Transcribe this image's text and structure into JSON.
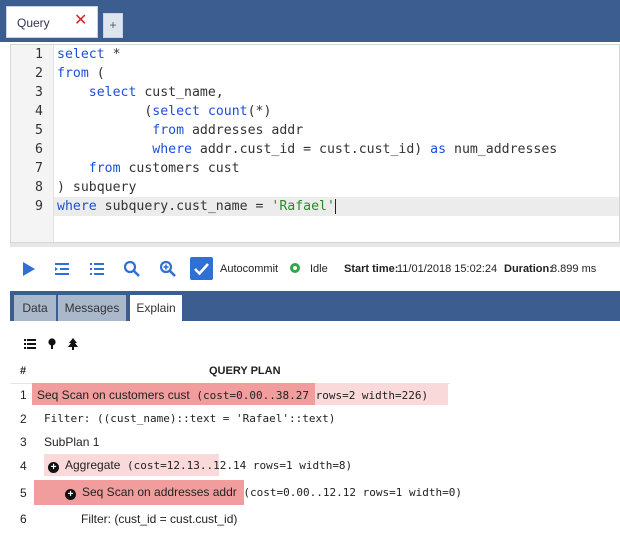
{
  "query_tab": {
    "label": "Query",
    "close": "✕",
    "add": "+"
  },
  "editor": {
    "lines": [
      {
        "n": "1",
        "parts": [
          {
            "t": "select",
            "c": "kw"
          },
          {
            "t": " *",
            "c": ""
          }
        ]
      },
      {
        "n": "2",
        "parts": [
          {
            "t": "from",
            "c": "kw"
          },
          {
            "t": " (",
            "c": ""
          }
        ]
      },
      {
        "n": "3",
        "parts": [
          {
            "t": "    ",
            "c": ""
          },
          {
            "t": "select",
            "c": "kw"
          },
          {
            "t": " cust_name,",
            "c": ""
          }
        ]
      },
      {
        "n": "4",
        "parts": [
          {
            "t": "           (",
            "c": ""
          },
          {
            "t": "select",
            "c": "kw"
          },
          {
            "t": " ",
            "c": ""
          },
          {
            "t": "count",
            "c": "kw"
          },
          {
            "t": "(*)",
            "c": ""
          }
        ]
      },
      {
        "n": "5",
        "parts": [
          {
            "t": "            ",
            "c": ""
          },
          {
            "t": "from",
            "c": "kw"
          },
          {
            "t": " addresses addr",
            "c": ""
          }
        ]
      },
      {
        "n": "6",
        "parts": [
          {
            "t": "            ",
            "c": ""
          },
          {
            "t": "where",
            "c": "kw"
          },
          {
            "t": " addr.cust_id = cust.cust_id) ",
            "c": ""
          },
          {
            "t": "as",
            "c": "kw"
          },
          {
            "t": " num_addresses",
            "c": ""
          }
        ]
      },
      {
        "n": "7",
        "parts": [
          {
            "t": "    ",
            "c": ""
          },
          {
            "t": "from",
            "c": "kw"
          },
          {
            "t": " customers cust",
            "c": ""
          }
        ]
      },
      {
        "n": "8",
        "parts": [
          {
            "t": ") subquery",
            "c": ""
          }
        ]
      },
      {
        "n": "9",
        "parts": [
          {
            "t": "where",
            "c": "kw"
          },
          {
            "t": " subquery.cust_name = ",
            "c": ""
          },
          {
            "t": "'Rafael'",
            "c": "str"
          }
        ]
      }
    ]
  },
  "toolbar": {
    "buttons": [
      "run-icon",
      "indent-icon",
      "list-icon",
      "search-icon",
      "zoom-icon"
    ],
    "autocommit_label": "Autocommit",
    "status_label": "Idle",
    "start_time_label": "Start time:",
    "start_time_value": "11/01/2018 15:02:24",
    "duration_label": "Duration:",
    "duration_value": "8.899 ms"
  },
  "result_tabs": [
    {
      "label": "Data",
      "active": false
    },
    {
      "label": "Messages",
      "active": false
    },
    {
      "label": "Explain",
      "active": true
    }
  ],
  "plan": {
    "header_num": "#",
    "header_title": "QUERY PLAN",
    "rows": [
      {
        "n": "1",
        "op": "Seq Scan on customers cust",
        "detail": " (cost=0.00..38.27 rows=2 width=226)",
        "expand": false
      },
      {
        "n": "2",
        "op": "",
        "detail": "Filter: ((cust_name)::text = 'Rafael'::text)",
        "expand": false
      },
      {
        "n": "3",
        "op": "SubPlan 1",
        "detail": "",
        "expand": false
      },
      {
        "n": "4",
        "op": "Aggregate",
        "detail": " (cost=12.13..12.14 rows=1 width=8)",
        "expand": true
      },
      {
        "n": "5",
        "op": "Seq Scan on addresses addr",
        "detail": " (cost=0.00..12.12 rows=1 width=0)",
        "expand": true
      },
      {
        "n": "6",
        "op": "Filter: (cust_id = cust.cust_id)",
        "detail": "",
        "expand": false
      }
    ]
  },
  "colors": {
    "header_bg": "#3c5d8f",
    "keyword": "#1a4fd8",
    "string": "#2a8a2a",
    "cost_light": "#f9d9d9",
    "cost_dark": "#f19d9d"
  }
}
